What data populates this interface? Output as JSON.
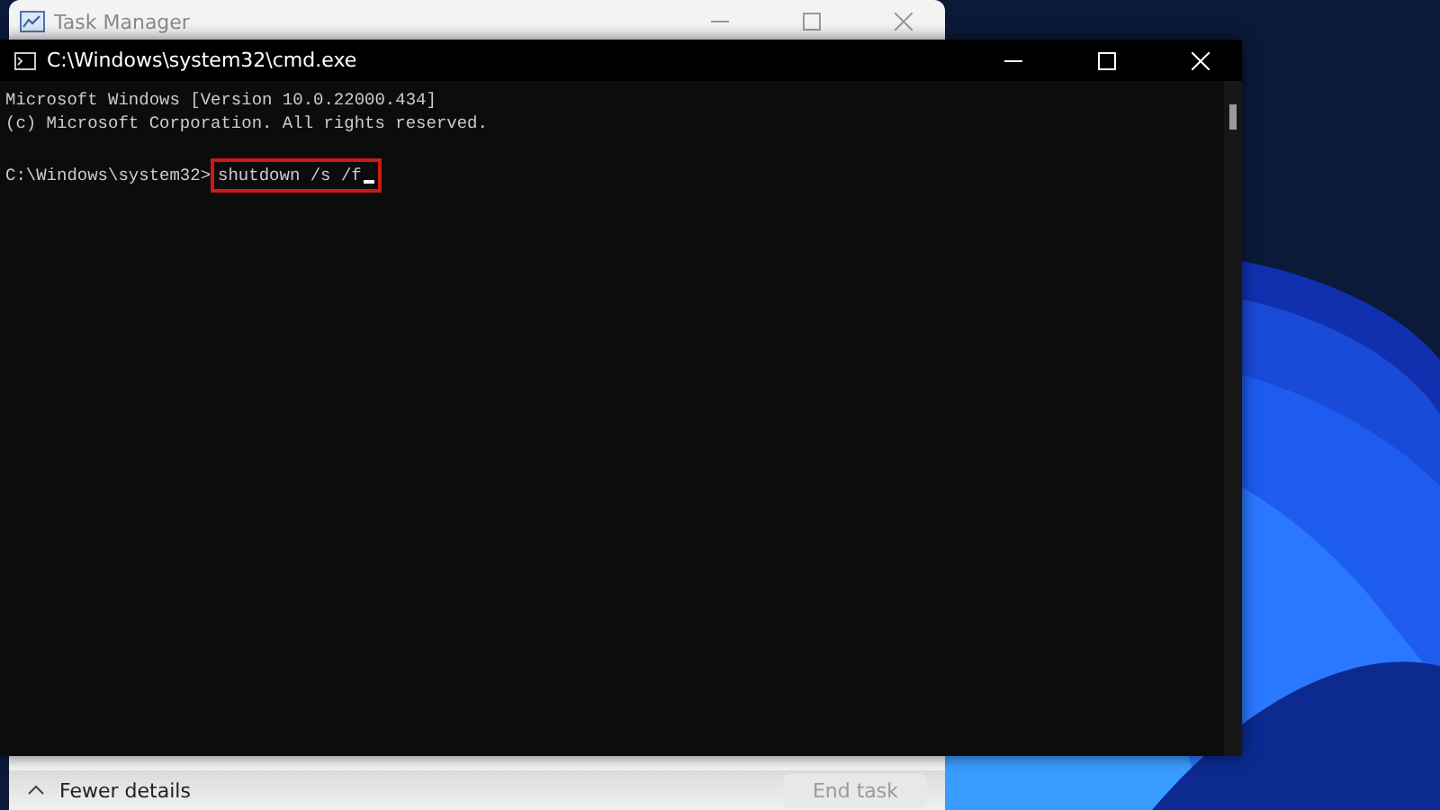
{
  "task_manager": {
    "title": "Task Manager",
    "footer": {
      "toggle": "Fewer details",
      "end_task": {
        "label": "End task",
        "disabled": true
      }
    }
  },
  "cmd": {
    "title": "C:\\Windows\\system32\\cmd.exe",
    "lines": [
      "Microsoft Windows [Version 10.0.22000.434]",
      "(c) Microsoft Corporation. All rights reserved."
    ],
    "prompt": "C:\\Windows\\system32>",
    "command": "shutdown /s /f",
    "command_highlighted": true
  }
}
